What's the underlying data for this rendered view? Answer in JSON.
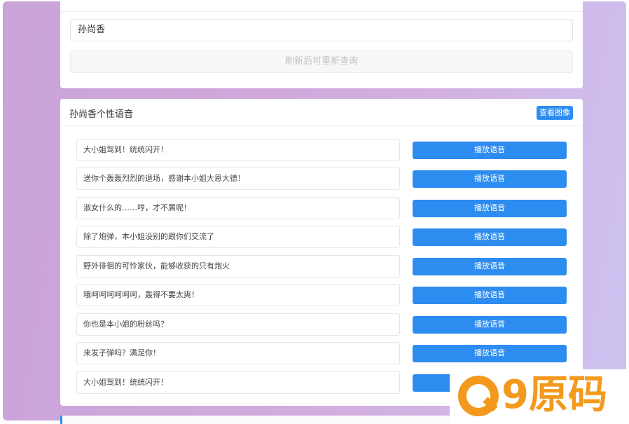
{
  "top_section": {
    "name_value": "孙尚香",
    "refresh_label": "刷新后可重新查询"
  },
  "voice_section": {
    "title": "孙尚香个性语音",
    "view_image_label": "查看图像",
    "play_label": "播放语音",
    "phrases": [
      "大小姐驾到！统统闪开！",
      "送你个轰轰烈烈的退场，感谢本小姐大恩大德！",
      "淑女什么的……哼，才不屑呢！",
      "除了炮弹，本小姐没别的跟你们交流了",
      "野外徘徊的可怜家伙，能够收获的只有炮火",
      "哦呵呵呵呵呵呵，轰得不要太爽！",
      "你也是本小姐的粉丝吗？",
      "来发子弹吗？满足你！",
      "大小姐驾到！统统闪开！"
    ]
  },
  "watermark": {
    "digit": "9",
    "text": "原码"
  },
  "colors": {
    "accent": "#2d8cf0",
    "watermark": "#f39a1e"
  }
}
